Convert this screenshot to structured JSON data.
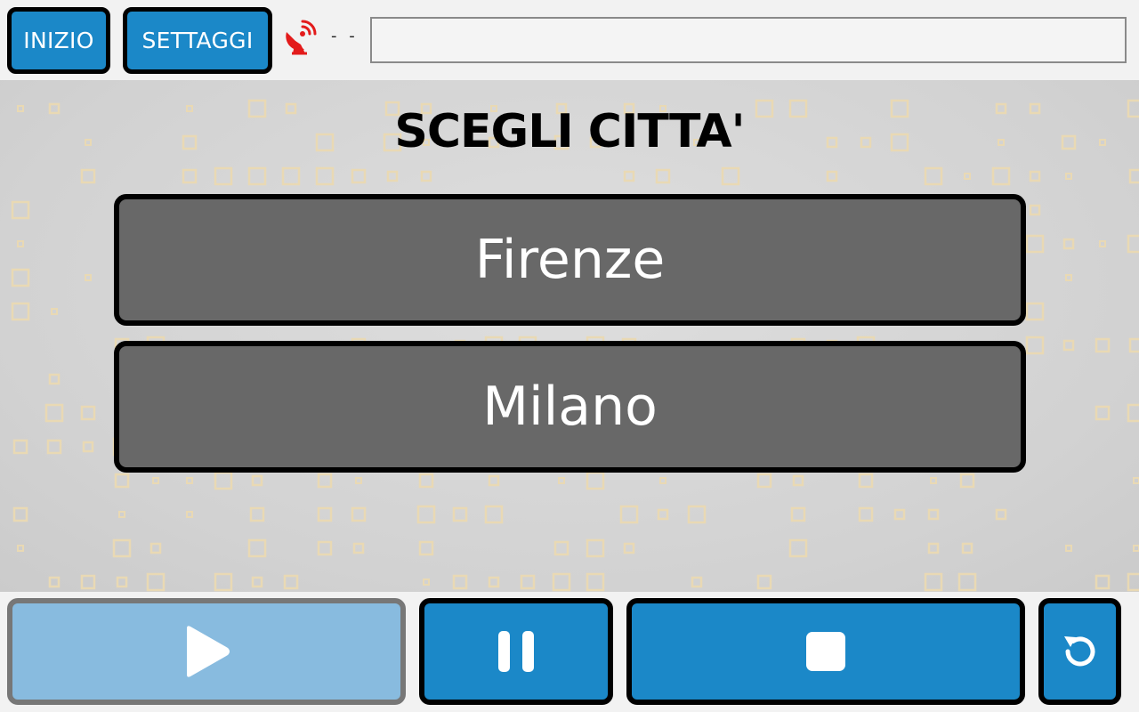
{
  "header": {
    "home_label": "INIZIO",
    "settings_label": "SETTAGGI",
    "signal_icon": "satellite-dish-icon",
    "signal_color": "#e31b1b",
    "signal_status": "- -",
    "display_value": ""
  },
  "main": {
    "title": "SCEGLI CITTA'",
    "cities": [
      {
        "label": "Firenze"
      },
      {
        "label": "Milano"
      }
    ]
  },
  "controls": [
    {
      "name": "play",
      "icon": "play-icon",
      "enabled": false
    },
    {
      "name": "pause",
      "icon": "pause-icon",
      "enabled": true
    },
    {
      "name": "stop",
      "icon": "stop-icon",
      "enabled": true
    },
    {
      "name": "reload",
      "icon": "reload-icon",
      "enabled": true
    }
  ],
  "colors": {
    "button_blue": "#1b88c8",
    "button_disabled": "#88bbdf",
    "city_button": "#686868",
    "pattern_squares": "#e9d9b4"
  }
}
